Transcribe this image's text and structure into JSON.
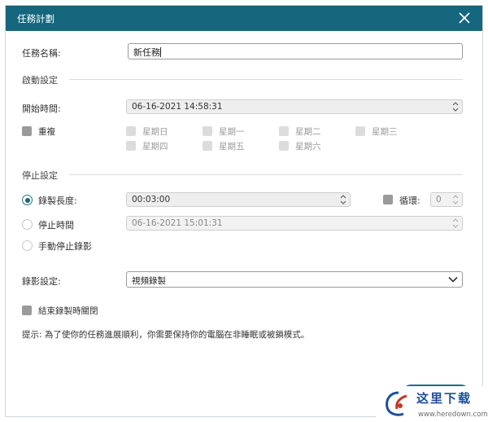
{
  "window": {
    "title": "任務計劃"
  },
  "task_name": {
    "label": "任務名稱:",
    "value": "新任務"
  },
  "start_section": {
    "heading": "啟動設定"
  },
  "start_time": {
    "label": "開始時間:",
    "value": "06-16-2021 14:58:31"
  },
  "repeat": {
    "label": "重複",
    "checked": true,
    "days": [
      "星期日",
      "星期一",
      "星期二",
      "星期三",
      "星期四",
      "星期五",
      "星期六"
    ]
  },
  "stop_section": {
    "heading": "停止設定"
  },
  "stop_options": {
    "duration": {
      "label": "錄製長度:",
      "value": "00:03:00",
      "selected": true
    },
    "loop": {
      "label": "循環:",
      "value": "0"
    },
    "stop_time": {
      "label": "停止時間",
      "value": "06-16-2021 15:01:31",
      "selected": false
    },
    "manual": {
      "label": "手動停止錄影",
      "selected": false
    }
  },
  "record_setting": {
    "label": "錄影設定:",
    "value": "視頻錄製"
  },
  "close_on_end": {
    "label": "結束錄製時關閉"
  },
  "hint": "提示: 為了使你的任務進展順利，你需要保持你的電腦在非睡眠或被鎖模式。",
  "watermark": {
    "text": "这里下载",
    "url": "www.heredown.com"
  },
  "colors": {
    "titlebar": "#15677e",
    "accent": "#15677e"
  }
}
